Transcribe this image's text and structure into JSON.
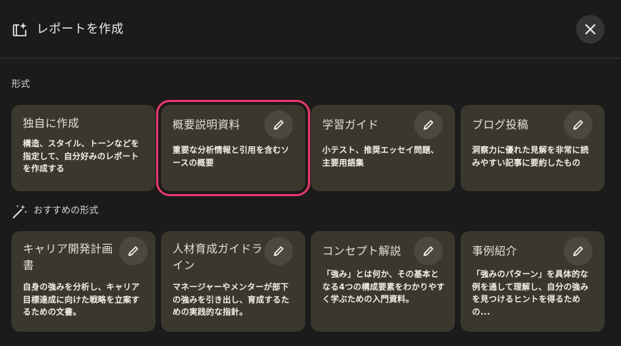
{
  "header": {
    "title": "レポートを作成",
    "icon": "report-sparkle-icon"
  },
  "sections": {
    "format_label": "形式",
    "recommended_label": "おすすめの形式"
  },
  "formats": [
    {
      "title": "独自に作成",
      "desc": "構造、スタイル、トーンなどを指定して、自分好みのレポートを作成する",
      "editable": false
    },
    {
      "title": "概要説明資料",
      "desc": "重要な分析情報と引用を含むソースの概要",
      "editable": true,
      "selected": true
    },
    {
      "title": "学習ガイド",
      "desc": "小テスト、推奨エッセイ問題、主要用語集",
      "editable": true
    },
    {
      "title": "ブログ投稿",
      "desc": "洞察力に優れた見解を非常に読みやすい記事に要約したもの",
      "editable": true
    }
  ],
  "recommended": [
    {
      "title": "キャリア開発計画書",
      "desc": "自身の強みを分析し、キャリア目標達成に向けた戦略を立案するための文書。",
      "editable": true
    },
    {
      "title": "人材育成ガイドライン",
      "desc": "マネージャーやメンターが部下の強みを引き出し、育成するための実践的な指針。",
      "editable": true
    },
    {
      "title": "コンセプト解説",
      "desc": "「強み」とは何か、その基本となる4つの構成要素をわかりやすく学ぶための入門資料。",
      "editable": true
    },
    {
      "title": "事例紹介",
      "desc": "「強みのパターン」を具体的な例を通して理解し、自分の強みを見つけるヒントを得るための...",
      "editable": true
    }
  ],
  "colors": {
    "card_bg": "#3a382d",
    "selected_outline": "#e8386a",
    "background": "#1b1b1b"
  }
}
